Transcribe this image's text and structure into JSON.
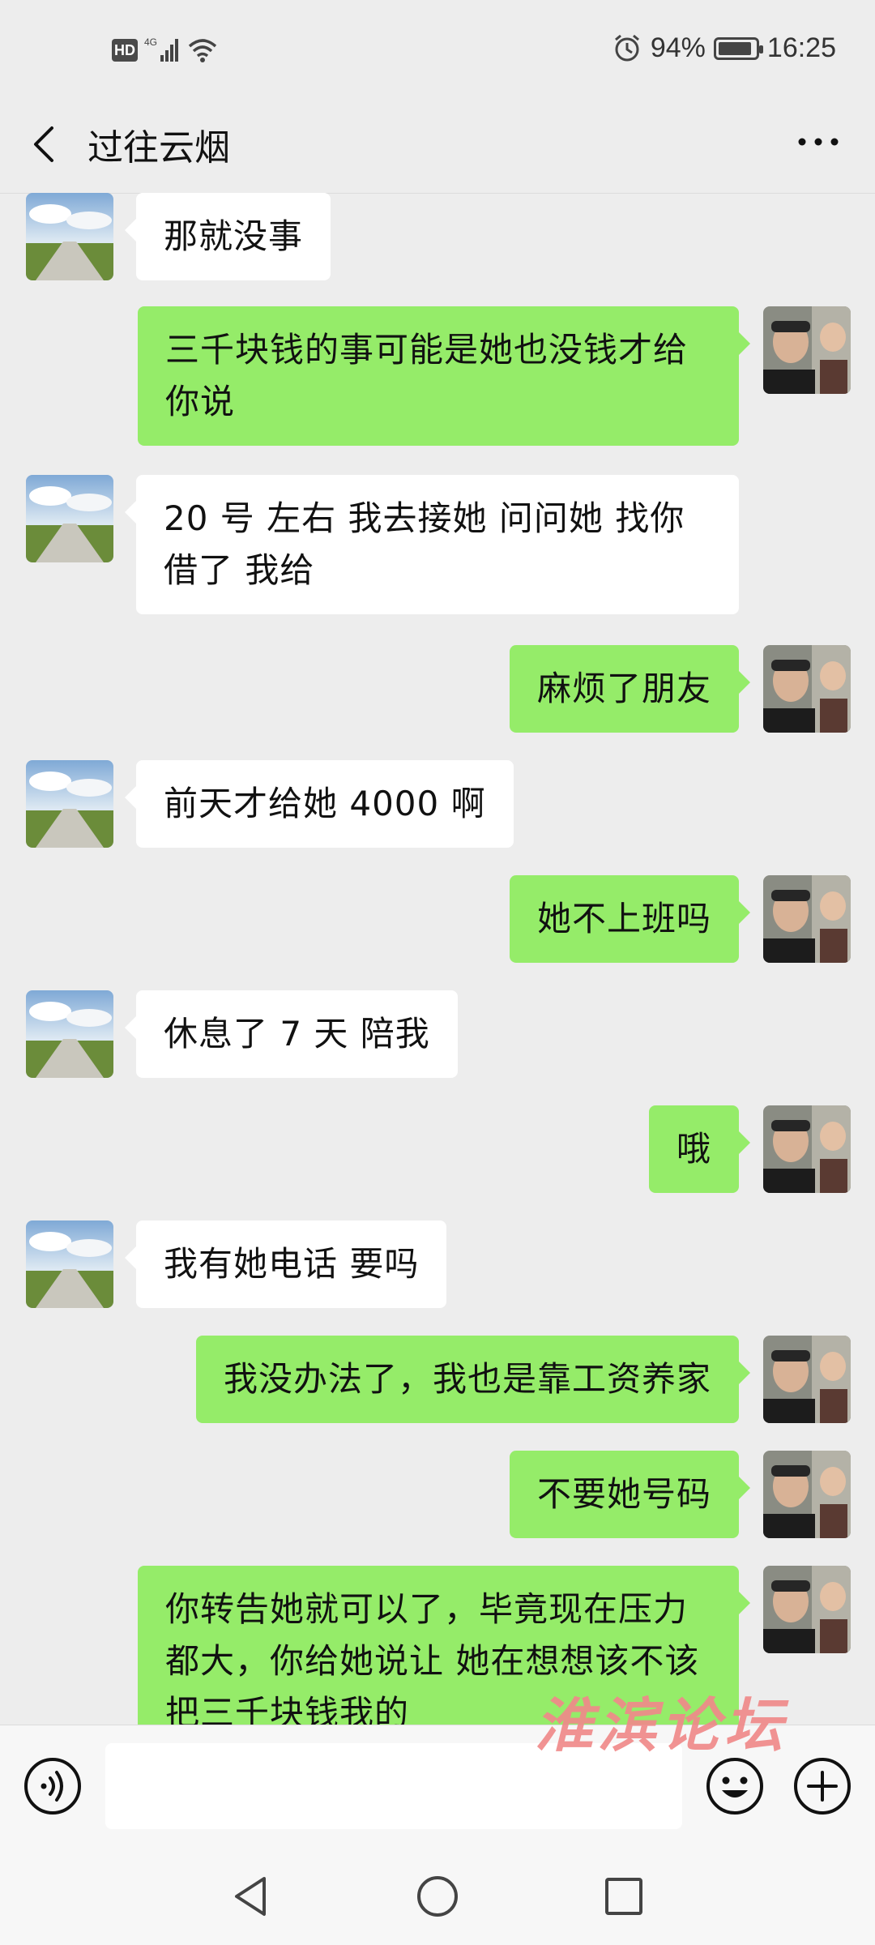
{
  "status_bar": {
    "hd_label": "HD",
    "network_label": "4G",
    "battery_percent_text": "94%",
    "battery_level": 0.94,
    "time": "16:25"
  },
  "header": {
    "title": "过往云烟"
  },
  "messages": [
    {
      "side": "in",
      "text": "那就没事"
    },
    {
      "side": "out",
      "text": "三千块钱的事可能是她也没钱才给你说"
    },
    {
      "side": "in",
      "text": "20 号 左右 我去接她  问问她  找你借了 我给"
    },
    {
      "side": "out",
      "text": "麻烦了朋友"
    },
    {
      "side": "in",
      "text": "前天才给她 4000 啊"
    },
    {
      "side": "out",
      "text": "她不上班吗"
    },
    {
      "side": "in",
      "text": "休息了 7 天 陪我"
    },
    {
      "side": "out",
      "text": "哦"
    },
    {
      "side": "in",
      "text": "我有她电话 要吗"
    },
    {
      "side": "out",
      "text": "我没办法了，我也是靠工资养家"
    },
    {
      "side": "out",
      "text": "不要她号码"
    },
    {
      "side": "out",
      "text": "你转告她就可以了，毕竟现在压力都大，你给她说让 她在想想该不该把三千块钱我的"
    }
  ],
  "input_bar": {
    "input_value": ""
  },
  "watermark": {
    "text": "淮滨论坛"
  },
  "colors": {
    "background": "#ededed",
    "outgoing_bubble": "#95ec69",
    "incoming_bubble": "#ffffff"
  },
  "icons": [
    "back-icon",
    "more-icon",
    "voice-icon",
    "emoji-icon",
    "plus-icon",
    "alarm-icon",
    "signal-icon",
    "wifi-icon",
    "battery-icon",
    "nav-back-icon",
    "nav-home-icon",
    "nav-recent-icon"
  ]
}
